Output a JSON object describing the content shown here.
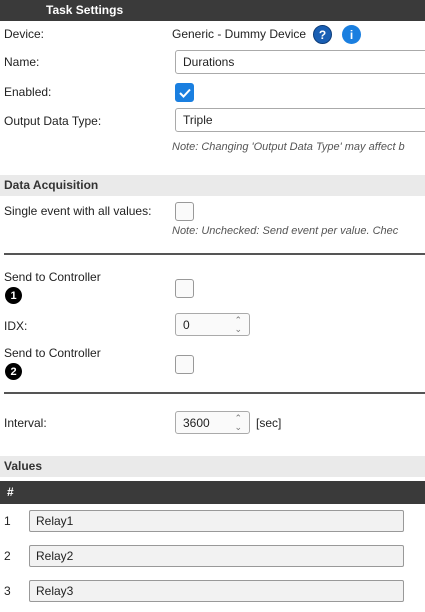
{
  "task_settings": {
    "header": "Task Settings",
    "device_label": "Device:",
    "device_value": "Generic - Dummy Device",
    "help_icon": "question-circle-icon",
    "info_icon": "info-circle-icon",
    "name_label": "Name:",
    "name_value": "Durations",
    "enabled_label": "Enabled:",
    "enabled_checked": true,
    "output_label": "Output Data Type:",
    "output_value": "Triple",
    "output_note": "Note: Changing 'Output Data Type' may affect b"
  },
  "data_acquisition": {
    "header": "Data Acquisition",
    "single_event_label": "Single event with all values:",
    "single_event_checked": false,
    "single_event_note": "Note: Unchecked: Send event per value. Chec",
    "controller1_label": "Send to Controller",
    "controller1_marker": "1",
    "controller1_checked": false,
    "idx_label": "IDX:",
    "idx_value": "0",
    "controller2_label": "Send to Controller",
    "controller2_marker": "2",
    "controller2_checked": false,
    "interval_label": "Interval:",
    "interval_value": "3600",
    "interval_unit": "[sec]"
  },
  "values": {
    "header": "Values",
    "column_header": "#",
    "rows": [
      {
        "num": "1",
        "name": "Relay1"
      },
      {
        "num": "2",
        "name": "Relay2"
      },
      {
        "num": "3",
        "name": "Relay3"
      }
    ]
  },
  "colors": {
    "header_dark": "#3a3a3a",
    "header_light": "#eaeaea",
    "accent_blue": "#1a7fe0"
  }
}
